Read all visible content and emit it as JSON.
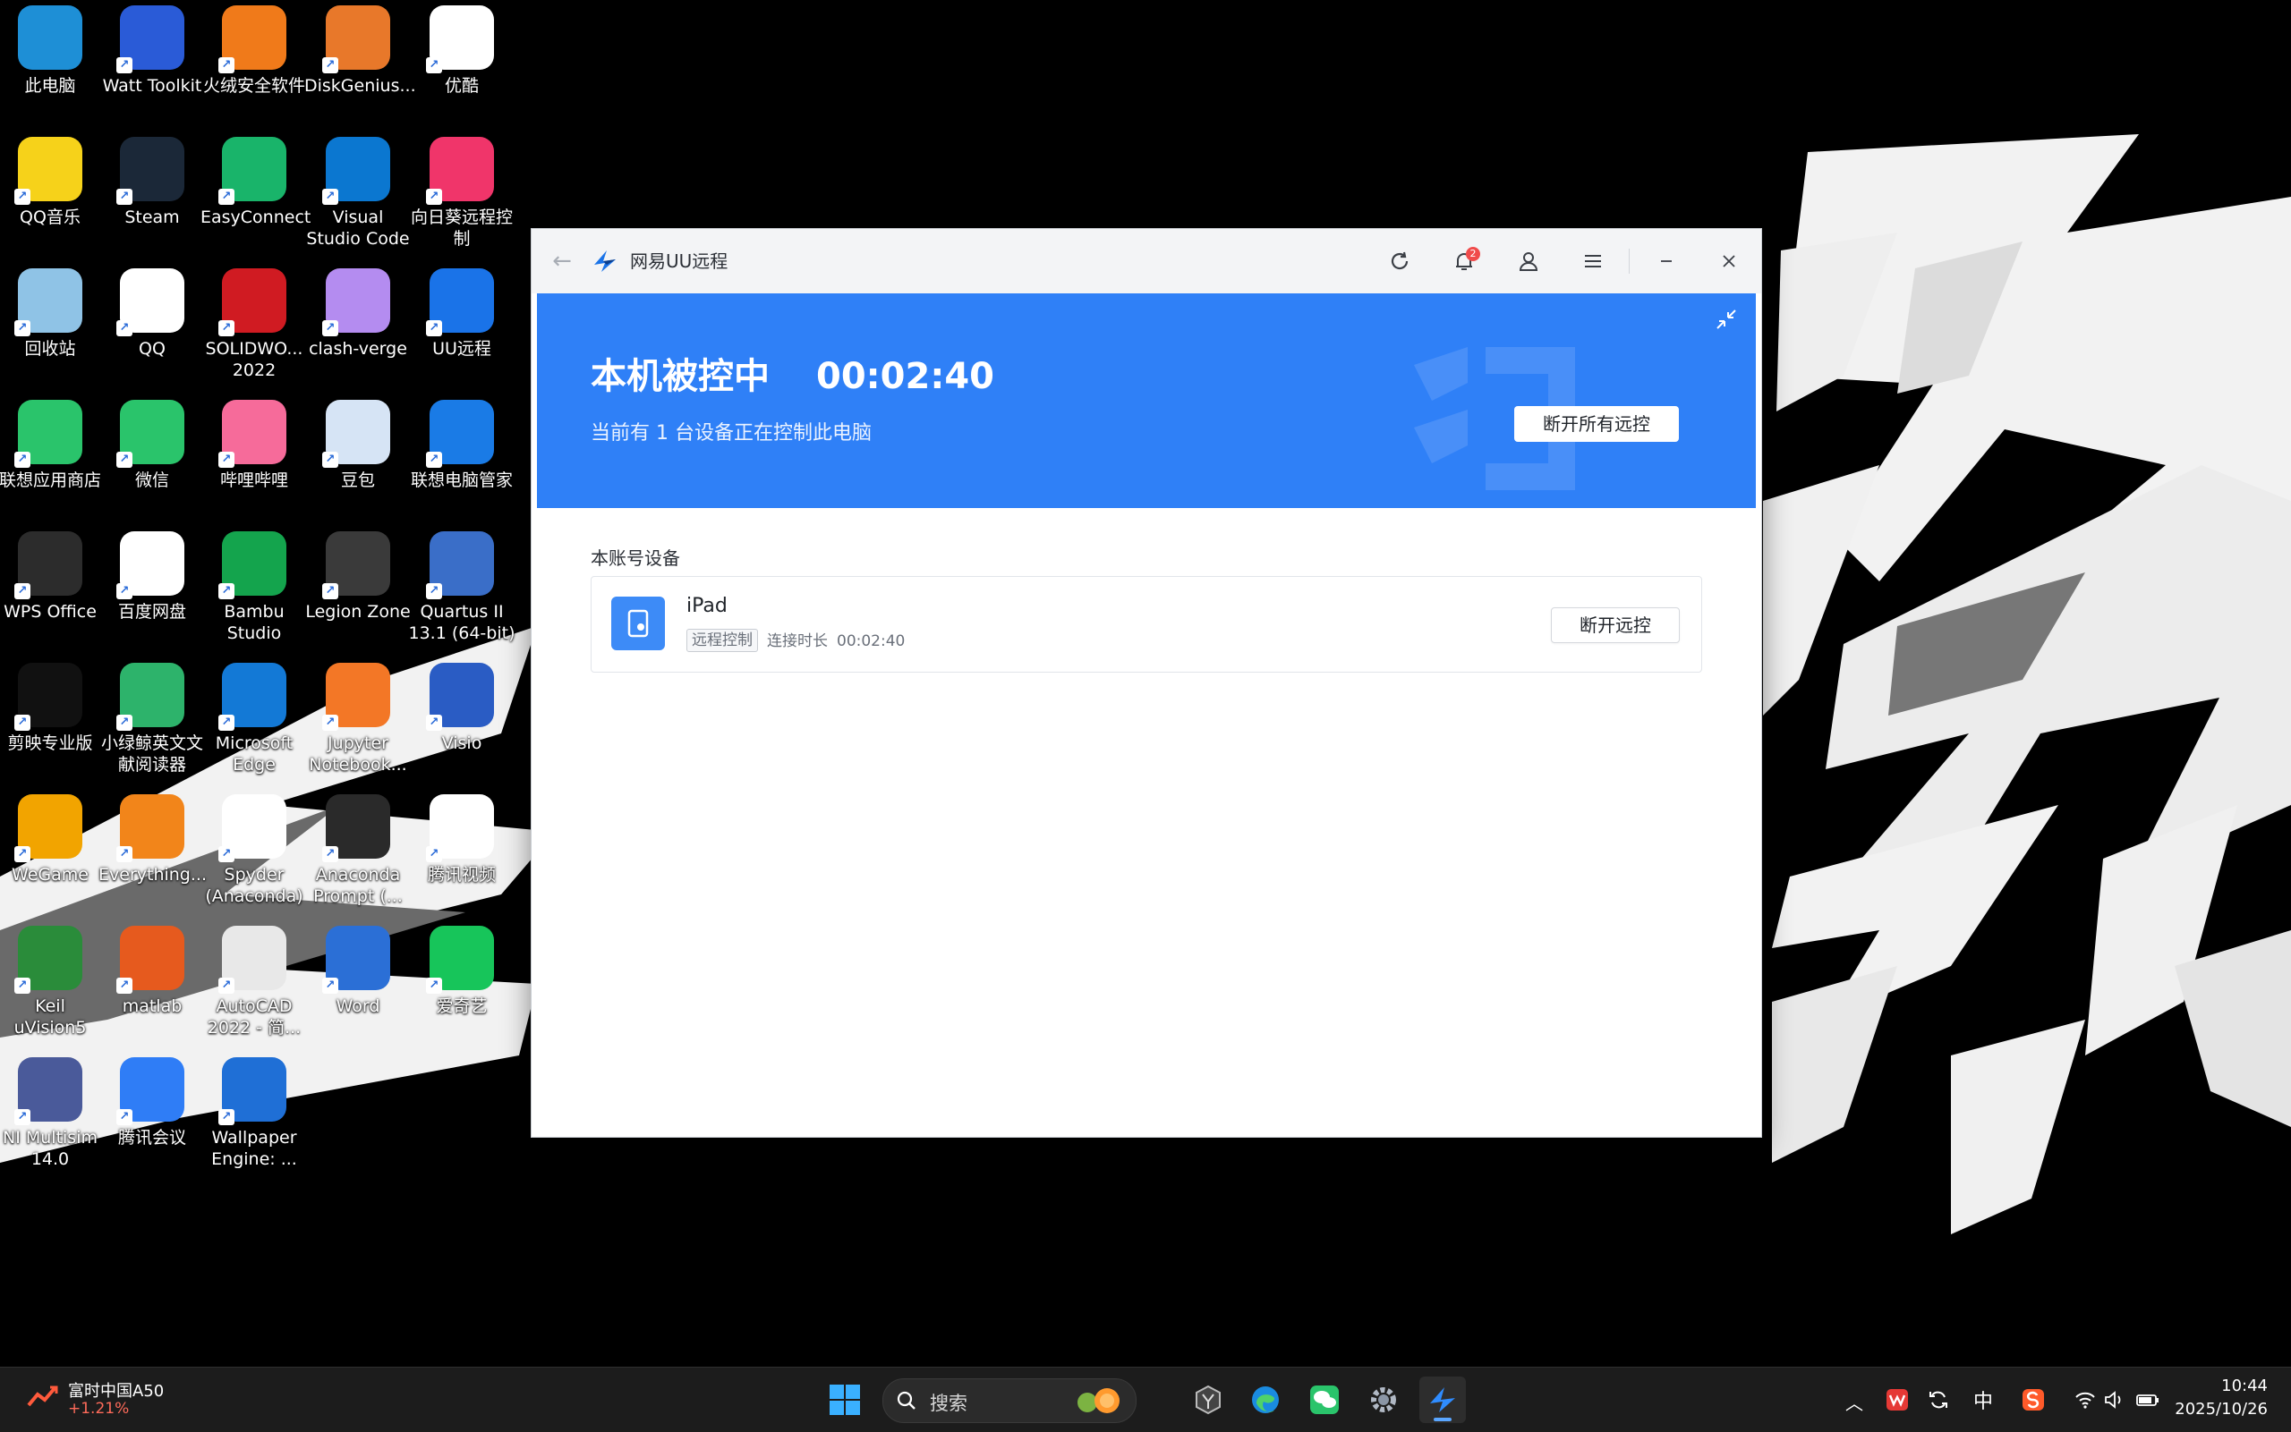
{
  "desktop": {
    "icons": [
      {
        "label": "此电脑",
        "color": "#1e8fd6"
      },
      {
        "label": "Watt Toolkit",
        "color": "#2a5bd7"
      },
      {
        "label": "火绒安全软件",
        "color": "#f07a1a"
      },
      {
        "label": "DiskGenius...",
        "color": "#e8782a"
      },
      {
        "label": "优酷",
        "color": "#ffffff"
      },
      {
        "label": "QQ音乐",
        "color": "#f6d21a"
      },
      {
        "label": "Steam",
        "color": "#1b2838"
      },
      {
        "label": "EasyConnect",
        "color": "#19b46a"
      },
      {
        "label": "Visual Studio Code",
        "color": "#0b77d0"
      },
      {
        "label": "向日葵远程控制",
        "color": "#f0356a"
      },
      {
        "label": "回收站",
        "color": "#8fc3e6"
      },
      {
        "label": "QQ",
        "color": "#ffffff"
      },
      {
        "label": "SOLIDWO... 2022",
        "color": "#d01b22"
      },
      {
        "label": "clash-verge",
        "color": "#b48cf0"
      },
      {
        "label": "UU远程",
        "color": "#1a73e8"
      },
      {
        "label": "联想应用商店",
        "color": "#2ac46b"
      },
      {
        "label": "微信",
        "color": "#2ac46b"
      },
      {
        "label": "哔哩哔哩",
        "color": "#f66b9a"
      },
      {
        "label": "豆包",
        "color": "#d6e4f5"
      },
      {
        "label": "联想电脑管家",
        "color": "#1a7be6"
      },
      {
        "label": "WPS Office",
        "color": "#2c2c2c"
      },
      {
        "label": "百度网盘",
        "color": "#ffffff"
      },
      {
        "label": "Bambu Studio",
        "color": "#14a44d"
      },
      {
        "label": "Legion Zone",
        "color": "#3a3a3a"
      },
      {
        "label": "Quartus II 13.1 (64-bit)",
        "color": "#3a6ec8"
      },
      {
        "label": "剪映专业版",
        "color": "#111111"
      },
      {
        "label": "小绿鲸英文文献阅读器",
        "color": "#2db36b"
      },
      {
        "label": "Microsoft Edge",
        "color": "#1379d6"
      },
      {
        "label": "Jupyter Notebook...",
        "color": "#f37726"
      },
      {
        "label": "Visio",
        "color": "#2a5cc4"
      },
      {
        "label": "WeGame",
        "color": "#f2a400"
      },
      {
        "label": "Everything...",
        "color": "#f2851a"
      },
      {
        "label": "Spyder (Anaconda)",
        "color": "#ffffff"
      },
      {
        "label": "Anaconda Prompt (...",
        "color": "#2a2a2a"
      },
      {
        "label": "腾讯视频",
        "color": "#ffffff"
      },
      {
        "label": "Keil uVision5",
        "color": "#2a8c3a"
      },
      {
        "label": "matlab",
        "color": "#e65a1e"
      },
      {
        "label": "AutoCAD 2022 - 简...",
        "color": "#e8e8e8"
      },
      {
        "label": "Word",
        "color": "#2b6fd6"
      },
      {
        "label": "爱奇艺",
        "color": "#17c55a"
      },
      {
        "label": "NI Multisim 14.0",
        "color": "#4a5a9a"
      },
      {
        "label": "腾讯会议",
        "color": "#2f7df6"
      },
      {
        "label": "Wallpaper Engine: ...",
        "color": "#1f6fd6"
      }
    ]
  },
  "window": {
    "app_title": "网易UU远程",
    "notification_count": "2",
    "banner": {
      "title": "本机被控中",
      "timer": "00:02:40",
      "subtitle": "当前有 1 台设备正在控制此电脑",
      "disconnect_all_label": "断开所有远控"
    },
    "section_label": "本账号设备",
    "device": {
      "name": "iPad",
      "tag": "远程控制",
      "duration_label": "连接时长",
      "duration": "00:02:40",
      "disconnect_label": "断开远控"
    },
    "accent_color": "#2f80f7"
  },
  "taskbar": {
    "stock_name": "富时中国A50",
    "stock_change": "+1.21%",
    "search_placeholder": "搜索",
    "ime_label": "中",
    "time": "10:44",
    "date": "2025/10/26"
  }
}
